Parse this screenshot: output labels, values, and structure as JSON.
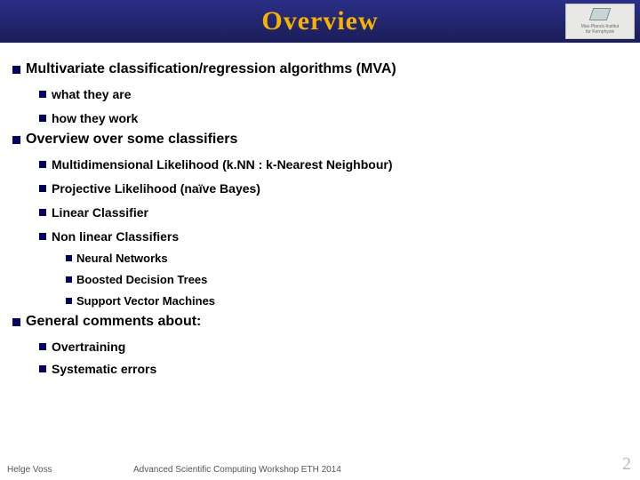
{
  "title": "Overview",
  "logo": {
    "line1": "Max-Planck-Institut",
    "line2": "für Kernphysik"
  },
  "bullets": {
    "mva": "Multivariate  classification/regression  algorithms  (MVA)",
    "what": "what they are",
    "how": "how they work",
    "overviewClassifiers": "Overview over some classifiers",
    "mlh": "Multidimensional Likelihood  (k.NN : k-Nearest Neighbour)",
    "proj": "Projective Likelihood (naïve Bayes)",
    "linear": "Linear Classifier",
    "nonlinear": "Non linear Classifiers",
    "nn": "Neural Networks",
    "bdt": "Boosted Decision Trees",
    "svm": "Support Vector Machines",
    "general": "General comments about:",
    "overtrain": "Overtraining",
    "syserr": "Systematic errors"
  },
  "footer": {
    "author": "Helge Voss",
    "event": "Advanced Scientific Computing Workshop ETH 2014",
    "page": "2"
  }
}
